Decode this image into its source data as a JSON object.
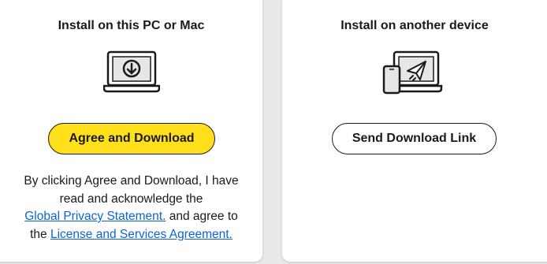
{
  "left_card": {
    "title": "Install on this PC or Mac",
    "illustration_icon": "laptop-download-icon",
    "button_label": "Agree and Download",
    "legal": {
      "line1": "By clicking Agree and Download, I have",
      "line2": "read and acknowledge the",
      "privacy_link": "Global Privacy Statement.",
      "middle": " and agree to",
      "the": "the ",
      "license_link": "License and Services Agreement."
    }
  },
  "right_card": {
    "title": "Install on another device",
    "illustration_icon": "phone-laptop-send-icon",
    "button_label": "Send Download Link"
  },
  "colors": {
    "accent_yellow": "#ffe01b",
    "link_blue": "#0a64d6",
    "text": "#1a1a1a"
  }
}
